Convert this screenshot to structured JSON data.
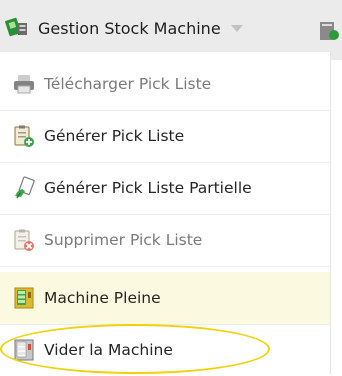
{
  "header": {
    "menu_label": "Gestion Stock Machine",
    "menu_icon": "vending-machine-icon",
    "next_icon": "report-icon"
  },
  "menu": {
    "items": [
      {
        "label": "Télécharger Pick Liste",
        "icon": "printer-icon",
        "enabled": false
      },
      {
        "label": "Générer Pick Liste",
        "icon": "clipboard-add-icon",
        "enabled": true
      },
      {
        "label": "Générer Pick Liste Partielle",
        "icon": "hand-clipboard-icon",
        "enabled": true
      },
      {
        "label": "Supprimer Pick Liste",
        "icon": "clipboard-delete-icon",
        "enabled": false
      },
      {
        "label": "Machine Pleine",
        "icon": "machine-full-icon",
        "enabled": true,
        "highlighted": true
      },
      {
        "label": "Vider la Machine",
        "icon": "machine-empty-icon",
        "enabled": true
      }
    ]
  },
  "colors": {
    "highlight_oval": "#f0d20a",
    "toolbar_bg": "#ebebeb"
  }
}
